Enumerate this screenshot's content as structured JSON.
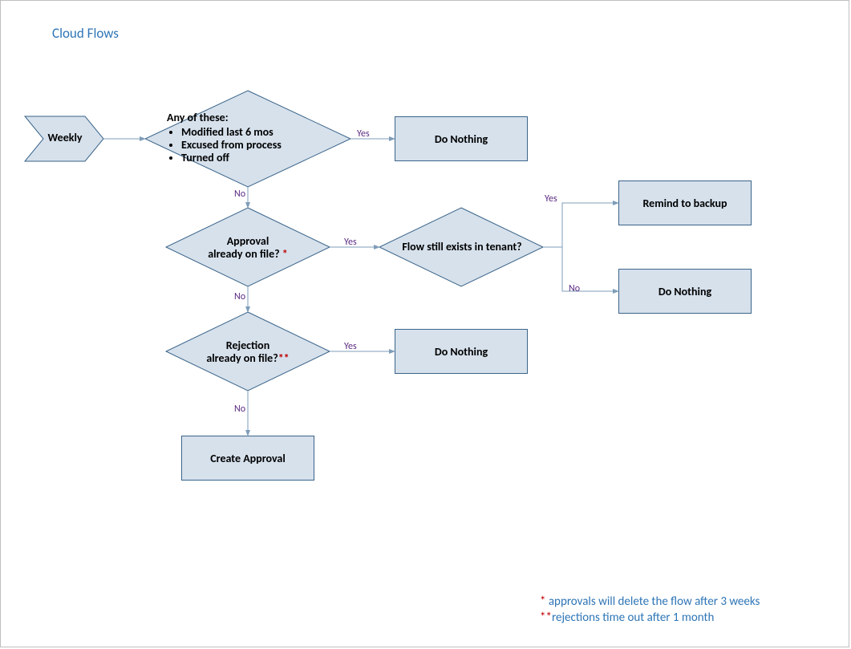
{
  "title": "Cloud Flows",
  "labels": {
    "yes": "Yes",
    "no": "No"
  },
  "start": {
    "label": "Weekly"
  },
  "decision1": {
    "header": "Any of these:",
    "items": [
      "Modified last 6 mos",
      "Excused from process",
      "Turned off"
    ]
  },
  "decision2": {
    "line1": "Approval",
    "line2": "already on file? ",
    "mark": "*"
  },
  "decision3": {
    "label": "Flow still exists in tenant?"
  },
  "decision4": {
    "line1": "Rejection",
    "line2": "already on file?",
    "mark": "**"
  },
  "boxes": {
    "doNothing1": "Do Nothing",
    "remindBackup": "Remind to backup",
    "doNothing2": "Do Nothing",
    "doNothing3": "Do Nothing",
    "createApproval": "Create Approval"
  },
  "footnotes": {
    "f1_mark": "* ",
    "f1_text": "approvals will delete the flow after 3 weeks",
    "f2_mark": "**",
    "f2_text": "rejections time out after 1 month"
  },
  "colors": {
    "fill": "#d6e1ec",
    "stroke": "#3b6489",
    "line": "#7f9db9",
    "edgeText": "#5a2a82",
    "title": "#2e75b6",
    "red": "#c00000"
  },
  "chart_data": {
    "type": "flowchart",
    "nodes": [
      {
        "id": "start",
        "type": "start-arrow",
        "label": "Weekly"
      },
      {
        "id": "d1",
        "type": "decision",
        "label": "Any of these: Modified last 6 mos / Excused from process / Turned off"
      },
      {
        "id": "p1",
        "type": "process",
        "label": "Do Nothing"
      },
      {
        "id": "d2",
        "type": "decision",
        "label": "Approval already on file? *"
      },
      {
        "id": "d3",
        "type": "decision",
        "label": "Flow still exists in tenant?"
      },
      {
        "id": "p2",
        "type": "process",
        "label": "Remind to backup"
      },
      {
        "id": "p3",
        "type": "process",
        "label": "Do Nothing"
      },
      {
        "id": "d4",
        "type": "decision",
        "label": "Rejection already on file? **"
      },
      {
        "id": "p4",
        "type": "process",
        "label": "Do Nothing"
      },
      {
        "id": "p5",
        "type": "process",
        "label": "Create Approval"
      }
    ],
    "edges": [
      {
        "from": "start",
        "to": "d1",
        "label": ""
      },
      {
        "from": "d1",
        "to": "p1",
        "label": "Yes"
      },
      {
        "from": "d1",
        "to": "d2",
        "label": "No"
      },
      {
        "from": "d2",
        "to": "d3",
        "label": "Yes"
      },
      {
        "from": "d3",
        "to": "p2",
        "label": "Yes"
      },
      {
        "from": "d3",
        "to": "p3",
        "label": "No"
      },
      {
        "from": "d2",
        "to": "d4",
        "label": "No"
      },
      {
        "from": "d4",
        "to": "p4",
        "label": "Yes"
      },
      {
        "from": "d4",
        "to": "p5",
        "label": "No"
      }
    ],
    "footnotes": [
      "* approvals will delete the flow after 3 weeks",
      "** rejections time out after 1 month"
    ]
  }
}
